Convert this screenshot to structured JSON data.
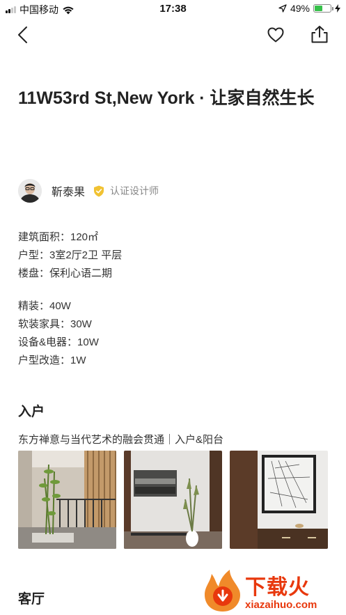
{
  "status_bar": {
    "carrier": "中国移动",
    "time": "17:38",
    "battery_percent": "49%",
    "battery_level": 0.49
  },
  "article": {
    "title": "11W53rd St,New York · 让家自然生长",
    "author": {
      "name": "靳泰果",
      "badge": "认证设计师"
    },
    "specs_basic": [
      "建筑面积：120㎡",
      "户型：3室2厅2卫 平层",
      "楼盘：保利心语二期"
    ],
    "specs_cost": [
      "精装：40W",
      "软装家具：30W",
      "设备&电器：10W",
      "户型改造：1W"
    ],
    "sections": [
      {
        "title": "入户",
        "subtitle": "东方禅意与当代艺术的融会贯通｜入户&阳台"
      },
      {
        "title": "客厅"
      }
    ]
  },
  "watermark": {
    "text": "下载火",
    "url": "xiazaihuo.com"
  },
  "colors": {
    "accent_badge": "#f1c232",
    "watermark": "#e8380d",
    "battery": "#36c04a"
  }
}
